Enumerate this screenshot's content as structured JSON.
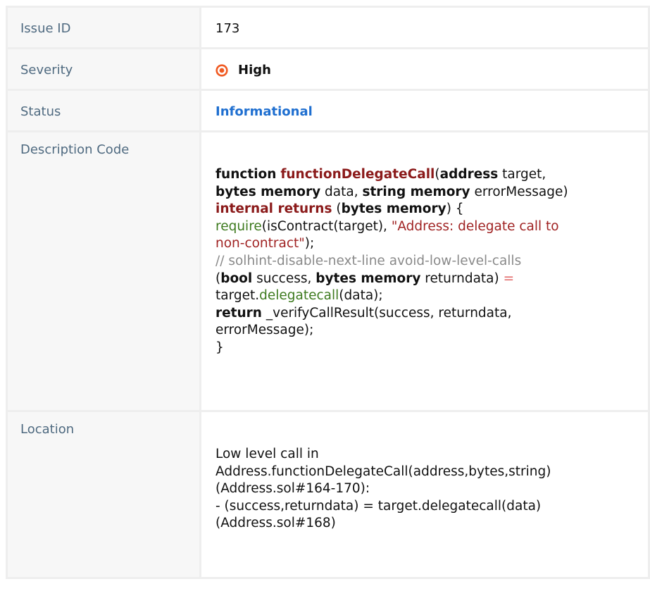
{
  "issue": {
    "id_label": "Issue ID",
    "id_value": "173",
    "severity_label": "Severity",
    "severity_value": "High",
    "severity_color": "#f05a22",
    "status_label": "Status",
    "status_value": "Informational",
    "status_color": "#1f6fd0",
    "description_label": "Description Code",
    "location_label": "Location"
  },
  "code": {
    "l1": {
      "kw1": "function",
      "name": "functionDelegateCall",
      "p1": "(",
      "kw2": "address",
      "t1": " target,"
    },
    "l2": {
      "kw1": "bytes memory",
      "t1": " data, ",
      "kw2": "string memory",
      "t2": " errorMessage)"
    },
    "l3": {
      "kw1": "internal returns",
      "t1": " (",
      "kw2": "bytes memory",
      "t2": ") {"
    },
    "l4": {
      "fn": "require",
      "t1": "(isContract(target), ",
      "str": "\"Address: delegate call to"
    },
    "l5": {
      "str": "non-contract\"",
      "t1": ");"
    },
    "l6": {
      "cmt": "// solhint-disable-next-line avoid-low-level-calls"
    },
    "l7": {
      "t1": "(",
      "kw1": "bool",
      "t2": " success, ",
      "kw2": "bytes memory",
      "t3": " returndata) ",
      "eq": "="
    },
    "l8": {
      "t1": "target.",
      "fn": "delegatecall",
      "t2": "(data);"
    },
    "l9": {
      "kw1": "return",
      "t1": " _verifyCallResult(success, returndata,"
    },
    "l10": {
      "t1": "errorMessage);"
    },
    "l11": {
      "t1": "}"
    }
  },
  "location": {
    "lines": [
      "Low level call in",
      "Address.functionDelegateCall(address,bytes,string)",
      "(Address.sol#164-170):",
      "- (success,returndata) = target.delegatecall(data)",
      "(Address.sol#168)"
    ]
  }
}
